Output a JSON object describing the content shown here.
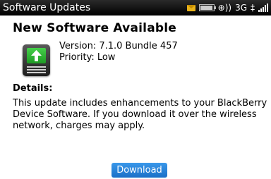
{
  "status_bar": {
    "title": "Software Updates",
    "wireless_glyph": "⊕))",
    "network": "3G",
    "network_extra": "‡",
    "icons": [
      "envelope-icon",
      "battery-icon",
      "wireless-icon",
      "signal-icon"
    ]
  },
  "main": {
    "heading": "New Software Available",
    "version_line": "Version: 7.1.0 Bundle 457",
    "priority_line": "Priority: Low",
    "details_label": "Details:",
    "details_lines": [
      "This update includes enhancements to your BlackBerry",
      "Device Software. If you download it over the wireless",
      "network, charges may apply."
    ],
    "download_label": "Download"
  },
  "colors": {
    "status_bar_bg": "#000000",
    "button_blue": "#2a80d8",
    "icon_green": "#33b53a",
    "envelope_yellow": "#e8b21a"
  }
}
